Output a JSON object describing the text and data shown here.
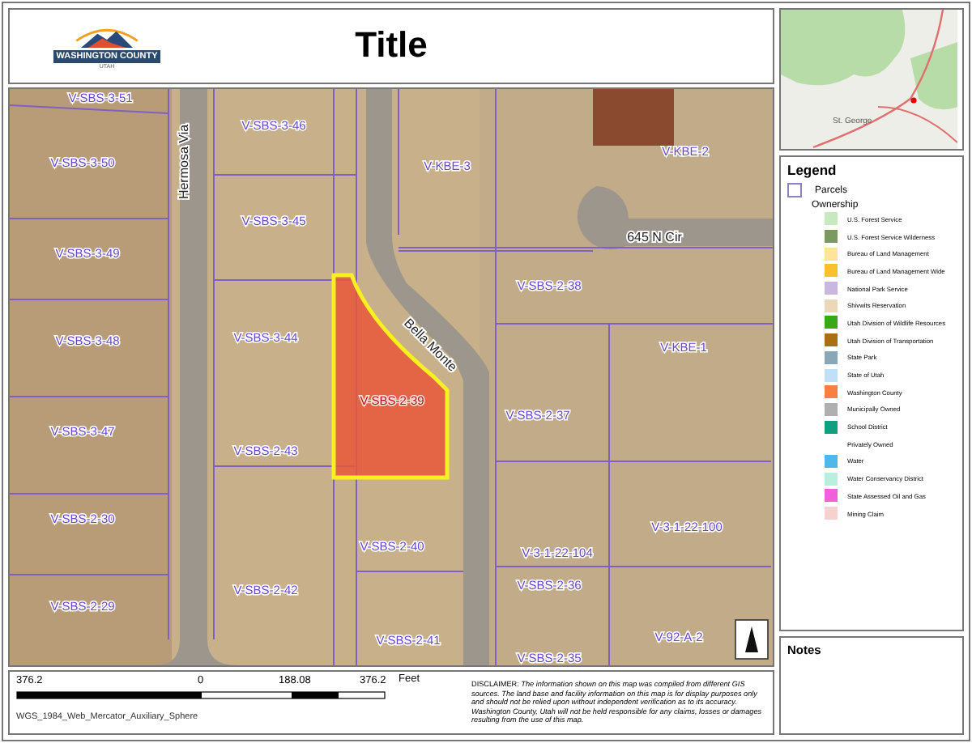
{
  "header": {
    "logo": {
      "name": "WASHINGTON COUNTY",
      "state": "UTAH"
    },
    "title": "Title"
  },
  "map": {
    "roads": [
      "Hermosa Via",
      "Bella Monte",
      "645 N Cir"
    ],
    "parcels": [
      {
        "label": "V-SBS-3-51",
        "selected": false
      },
      {
        "label": "V-SBS-3-46",
        "selected": false
      },
      {
        "label": "V-SBS-3-50",
        "selected": false
      },
      {
        "label": "V-SBS-3-45",
        "selected": false
      },
      {
        "label": "V-SBS-3-49",
        "selected": false
      },
      {
        "label": "V-SBS-3-44",
        "selected": false
      },
      {
        "label": "V-SBS-3-48",
        "selected": false
      },
      {
        "label": "V-KBE-3",
        "selected": false
      },
      {
        "label": "V-KBE-2",
        "selected": false
      },
      {
        "label": "V-SBS-2-38",
        "selected": false
      },
      {
        "label": "V-KBE-1",
        "selected": false
      },
      {
        "label": "V-SBS-2-39",
        "selected": true
      },
      {
        "label": "V-SBS-3-47",
        "selected": false
      },
      {
        "label": "V-SBS-2-43",
        "selected": false
      },
      {
        "label": "V-SBS-2-37",
        "selected": false
      },
      {
        "label": "V-3-1-22-100",
        "selected": false
      },
      {
        "label": "V-3-1-22-104",
        "selected": false
      },
      {
        "label": "V-SBS-2-30",
        "selected": false
      },
      {
        "label": "V-SBS-2-40",
        "selected": false
      },
      {
        "label": "V-SBS-2-36",
        "selected": false
      },
      {
        "label": "V-SBS-2-29",
        "selected": false
      },
      {
        "label": "V-SBS-2-42",
        "selected": false
      },
      {
        "label": "V-SBS-2-41",
        "selected": false
      },
      {
        "label": "V-SBS-2-35",
        "selected": false
      },
      {
        "label": "V-92-A-2",
        "selected": false
      }
    ]
  },
  "scale_bar": {
    "ticks": [
      "376.2",
      "0",
      "188.08",
      "376.2"
    ],
    "unit": "Feet",
    "projection": "WGS_1984_Web_Mercator_Auxiliary_Sphere"
  },
  "disclaimer": "DISCLAIMER: *The information shown on this map was compiled from different GIS sources. The land base and facility information on this map is for display purposes only and should not be relied upon without independent verification as to its accuracy. Washington County, Utah will not be held responsible for any claims, losses or damages resulting from the use of this map.*",
  "overview_map": {
    "place": "St. George"
  },
  "legend": {
    "title": "Legend",
    "layer": "Parcels",
    "group": "Ownership",
    "items": [
      {
        "label": "U.S. Forest Service",
        "color": "#c8e8c0"
      },
      {
        "label": "U.S. Forest Service Wilderness",
        "color": "#7a9a60"
      },
      {
        "label": "Bureau of Land Management",
        "color": "#fde49a"
      },
      {
        "label": "Bureau of Land Management Wide",
        "color": "#fbc02d"
      },
      {
        "label": "National Park Service",
        "color": "#c8b8e0"
      },
      {
        "label": "Shivwits Reservation",
        "color": "#ead8b8"
      },
      {
        "label": "Utah Division of Wildlife Resources",
        "color": "#38a818"
      },
      {
        "label": "Utah Division of Transportation",
        "color": "#a87010"
      },
      {
        "label": "State Park",
        "color": "#88a8b8"
      },
      {
        "label": "State of Utah",
        "color": "#c0e0f8"
      },
      {
        "label": "Washington County",
        "color": "#f88040"
      },
      {
        "label": "Municipally Owned",
        "color": "#b0b0b0"
      },
      {
        "label": "School District",
        "color": "#10a080"
      },
      {
        "label": "Privately Owned"
      },
      {
        "label": "Water",
        "color": "#50b8e8"
      },
      {
        "label": "Water Conservancy District",
        "color": "#b8f0e0"
      },
      {
        "label": "State Assessed Oil and Gas",
        "color": "#f060d8"
      },
      {
        "label": "Mining Claim",
        "color": "#f8d0d0"
      }
    ]
  },
  "notes": {
    "title": "Notes"
  }
}
